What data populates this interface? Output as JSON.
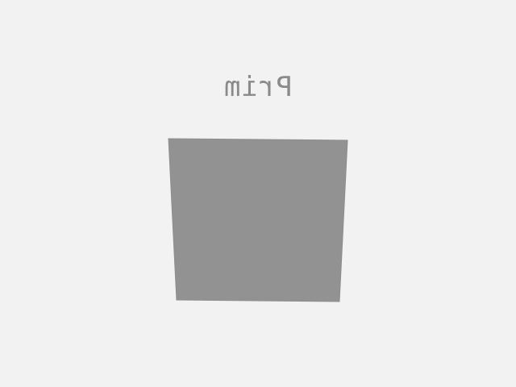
{
  "scene": {
    "label": "Prim",
    "background_color": "#f2f2f2",
    "label_color": "#8a8a8a",
    "shape_color": "#929292"
  }
}
